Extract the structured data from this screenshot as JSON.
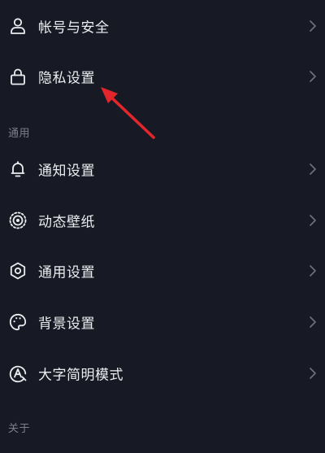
{
  "colors": {
    "background": "#171a24",
    "text": "#ecedf1",
    "section_text": "#7c7f89",
    "chevron": "#6f727c",
    "annotation_arrow": "#e3262b"
  },
  "items": [
    {
      "label": "帐号与安全",
      "icon": "person-icon"
    },
    {
      "label": "隐私设置",
      "icon": "lock-icon"
    },
    {
      "label": "通知设置",
      "icon": "bell-icon"
    },
    {
      "label": "动态壁纸",
      "icon": "dynamic-wallpaper-icon"
    },
    {
      "label": "通用设置",
      "icon": "gear-icon"
    },
    {
      "label": "背景设置",
      "icon": "palette-icon"
    },
    {
      "label": "大字简明模式",
      "icon": "font-size-icon"
    }
  ],
  "sections": {
    "general": "通用",
    "about": "关于"
  }
}
